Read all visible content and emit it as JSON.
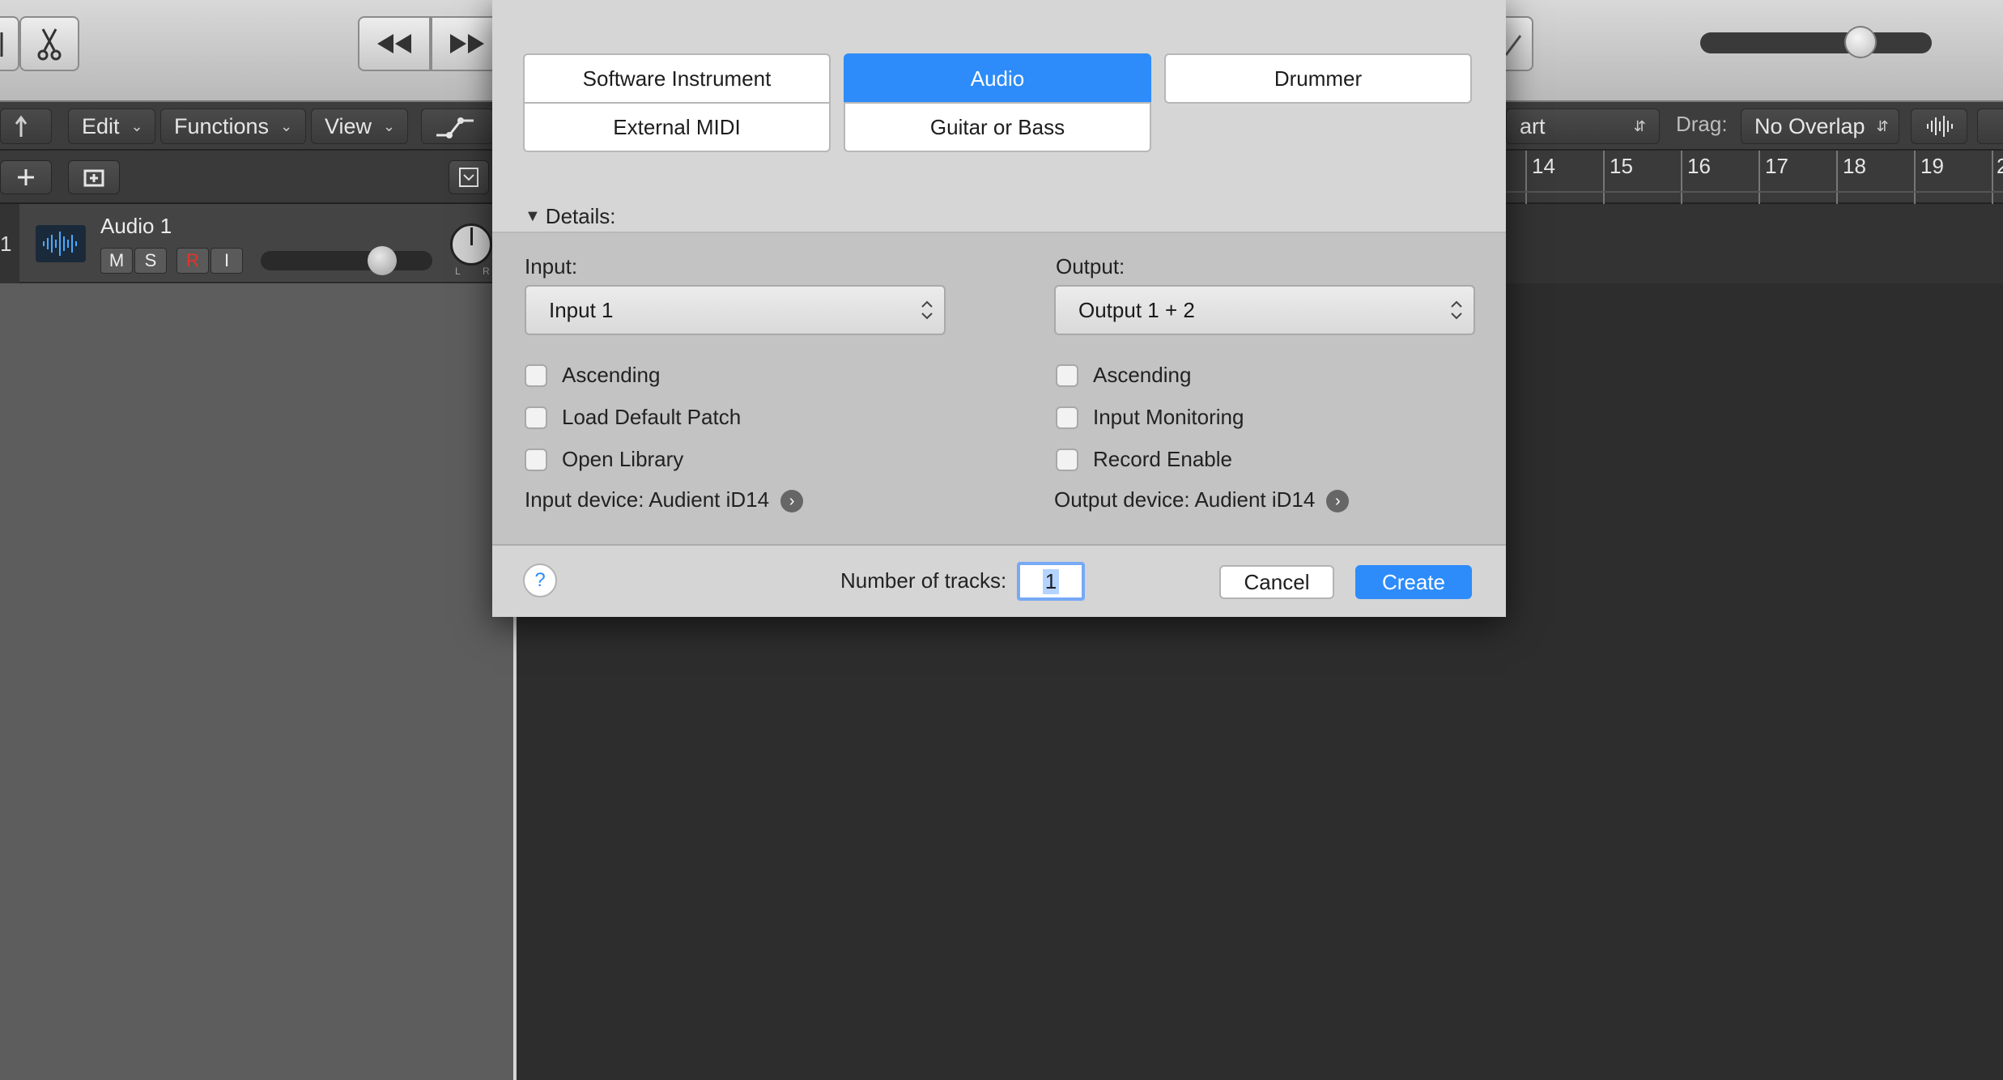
{
  "toolbar": {
    "menus": [
      {
        "label": "Edit"
      },
      {
        "label": "Functions"
      },
      {
        "label": "View"
      }
    ],
    "ruler_fragment": "art",
    "drag_label": "Drag:",
    "drag_value": "No Overlap"
  },
  "track": {
    "number": "1",
    "name": "Audio 1",
    "buttons": {
      "mute": "M",
      "solo": "S",
      "record": "R",
      "input": "I"
    },
    "pan_labels": {
      "left": "L",
      "right": "R"
    }
  },
  "ruler": {
    "bars": [
      "14",
      "15",
      "16",
      "17",
      "18",
      "19",
      "2"
    ]
  },
  "dialog": {
    "track_types": {
      "software_instrument": "Software Instrument",
      "audio": "Audio",
      "drummer": "Drummer",
      "external_midi": "External MIDI",
      "guitar_bass": "Guitar or Bass"
    },
    "details_label": "Details:",
    "input": {
      "label": "Input:",
      "value": "Input 1",
      "options": [
        "Ascending",
        "Load Default Patch",
        "Open Library"
      ],
      "device": "Input device: Audient iD14"
    },
    "output": {
      "label": "Output:",
      "value": "Output 1 + 2",
      "options": [
        "Ascending",
        "Input Monitoring",
        "Record Enable"
      ],
      "device": "Output device: Audient iD14"
    },
    "help": "?",
    "num_tracks_label": "Number of tracks:",
    "num_tracks_value": "1",
    "cancel": "Cancel",
    "create": "Create"
  },
  "colors": {
    "accent": "#2d8cfa",
    "record": "#e0352b",
    "dark_bg": "#2e2e2e",
    "panel_bg": "#5d5d5d"
  }
}
